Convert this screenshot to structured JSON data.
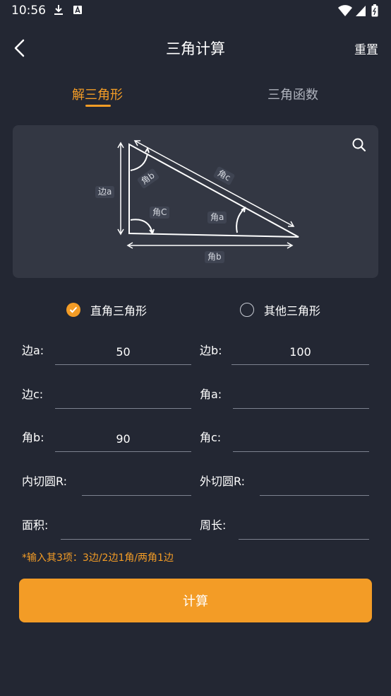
{
  "status_bar": {
    "time": "10:56",
    "icons": [
      "download-icon",
      "a-notification-icon",
      "wifi-icon",
      "signal-icon",
      "battery-icon"
    ]
  },
  "header": {
    "title": "三角计算",
    "reset_label": "重置",
    "back_icon": "chevron-left-icon"
  },
  "tabs": [
    {
      "label": "解三角形",
      "active": true
    },
    {
      "label": "三角函数",
      "active": false
    }
  ],
  "diagram": {
    "zoom_icon": "search-icon",
    "labels": {
      "side_a": "边a",
      "angle_b_top": "角b",
      "angle_c_hyp": "角c",
      "angle_C": "角C",
      "angle_a": "角a",
      "bottom_b": "角b"
    }
  },
  "triangle_type": {
    "options": [
      {
        "label": "直角三角形",
        "selected": true
      },
      {
        "label": "其他三角形",
        "selected": false
      }
    ]
  },
  "form": {
    "side_a": {
      "label": "边a:",
      "value": "50"
    },
    "side_b": {
      "label": "边b:",
      "value": "100"
    },
    "side_c": {
      "label": "边c:",
      "value": ""
    },
    "angle_a": {
      "label": "角a:",
      "value": ""
    },
    "angle_b": {
      "label": "角b:",
      "value": "90"
    },
    "angle_c": {
      "label": "角c:",
      "value": ""
    },
    "inradius": {
      "label": "内切圆R:",
      "value": ""
    },
    "circumradius": {
      "label": "外切圆R:",
      "value": ""
    },
    "area": {
      "label": "面积:",
      "value": ""
    },
    "perimeter": {
      "label": "周长:",
      "value": ""
    }
  },
  "hint": "*输入其3项：3边/2边1角/两角1边",
  "calculate_label": "计算",
  "colors": {
    "background": "#232733",
    "card": "#333743",
    "accent": "#f39c26",
    "inactive_text": "#aeb2bc"
  }
}
